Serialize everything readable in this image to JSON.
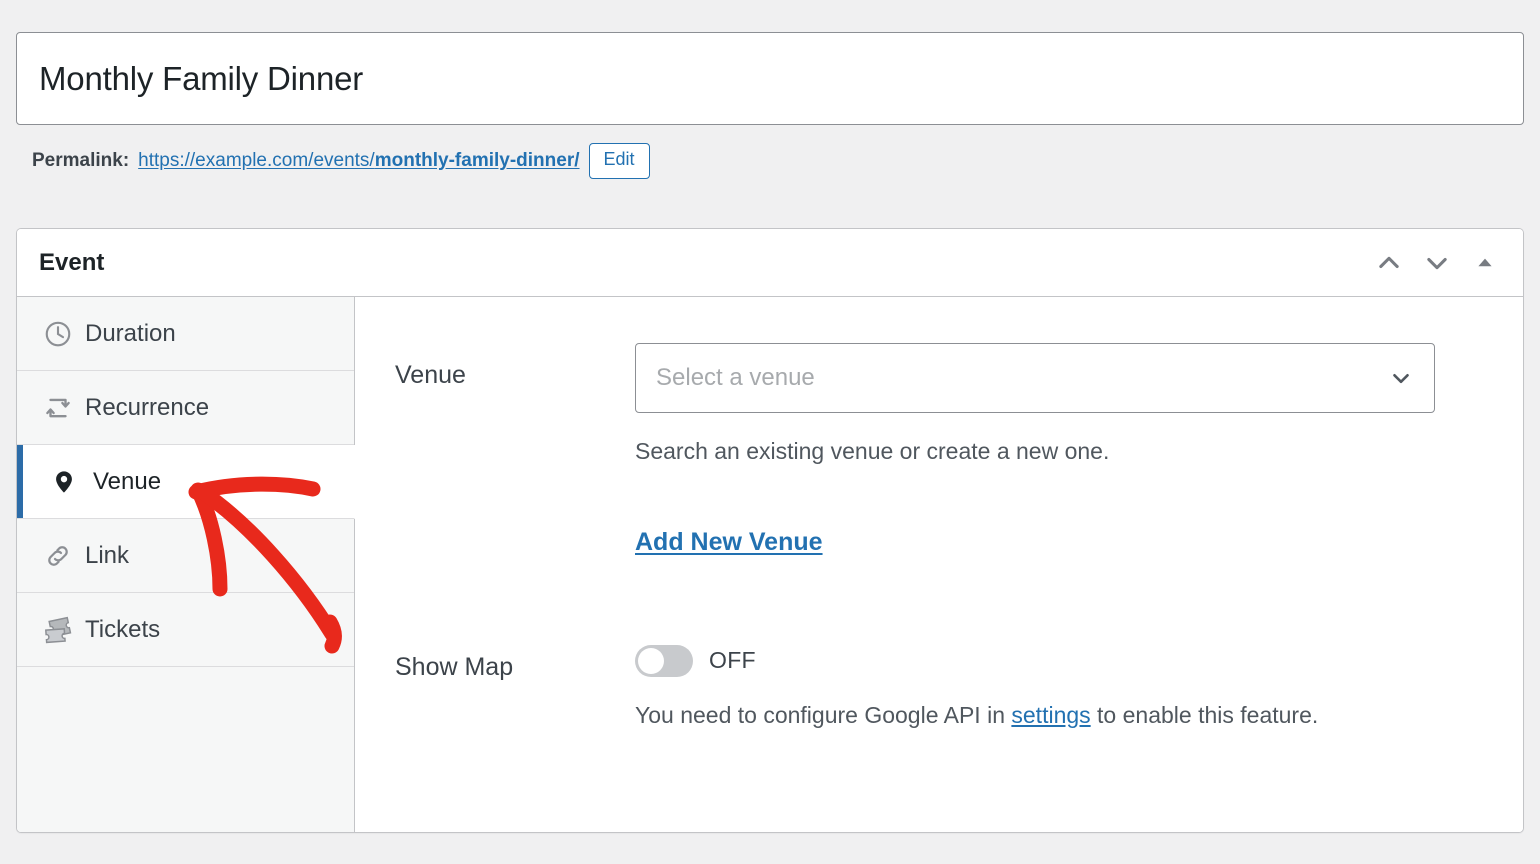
{
  "title_input": {
    "value": "Monthly Family Dinner",
    "placeholder": "Add title"
  },
  "permalink": {
    "label": "Permalink:",
    "url_base": "https://example.com/events/",
    "url_slug": "monthly-family-dinner/",
    "edit_label": "Edit"
  },
  "panel": {
    "title": "Event",
    "actions": [
      {
        "name": "move-up",
        "icon": "chevron-up-icon"
      },
      {
        "name": "move-down",
        "icon": "chevron-down-icon"
      },
      {
        "name": "toggle-panel",
        "icon": "triangle-up-icon"
      }
    ]
  },
  "tabs": [
    {
      "label": "Duration",
      "icon": "clock-icon",
      "active": false
    },
    {
      "label": "Recurrence",
      "icon": "repeat-icon",
      "active": false
    },
    {
      "label": "Venue",
      "icon": "map-pin-icon",
      "active": true
    },
    {
      "label": "Link",
      "icon": "link-icon",
      "active": false
    },
    {
      "label": "Tickets",
      "icon": "tickets-icon",
      "active": false
    }
  ],
  "fields": {
    "venue": {
      "label": "Venue",
      "placeholder": "Select a venue",
      "selected": "",
      "help": "Search an existing venue or create a new one.",
      "add_new_label": "Add New Venue"
    },
    "show_map": {
      "label": "Show Map",
      "state": "OFF",
      "enabled": false,
      "help_before": "You need to configure Google API in ",
      "help_link": "settings",
      "help_after": " to enable this feature."
    }
  },
  "colors": {
    "accent_blue": "#2271b1",
    "active_tab_bar": "#2c6ca8",
    "annotation_red": "#e8291c",
    "page_background": "#f0f0f1",
    "panel_background": "#ffffff",
    "tab_background": "#f6f7f7"
  }
}
